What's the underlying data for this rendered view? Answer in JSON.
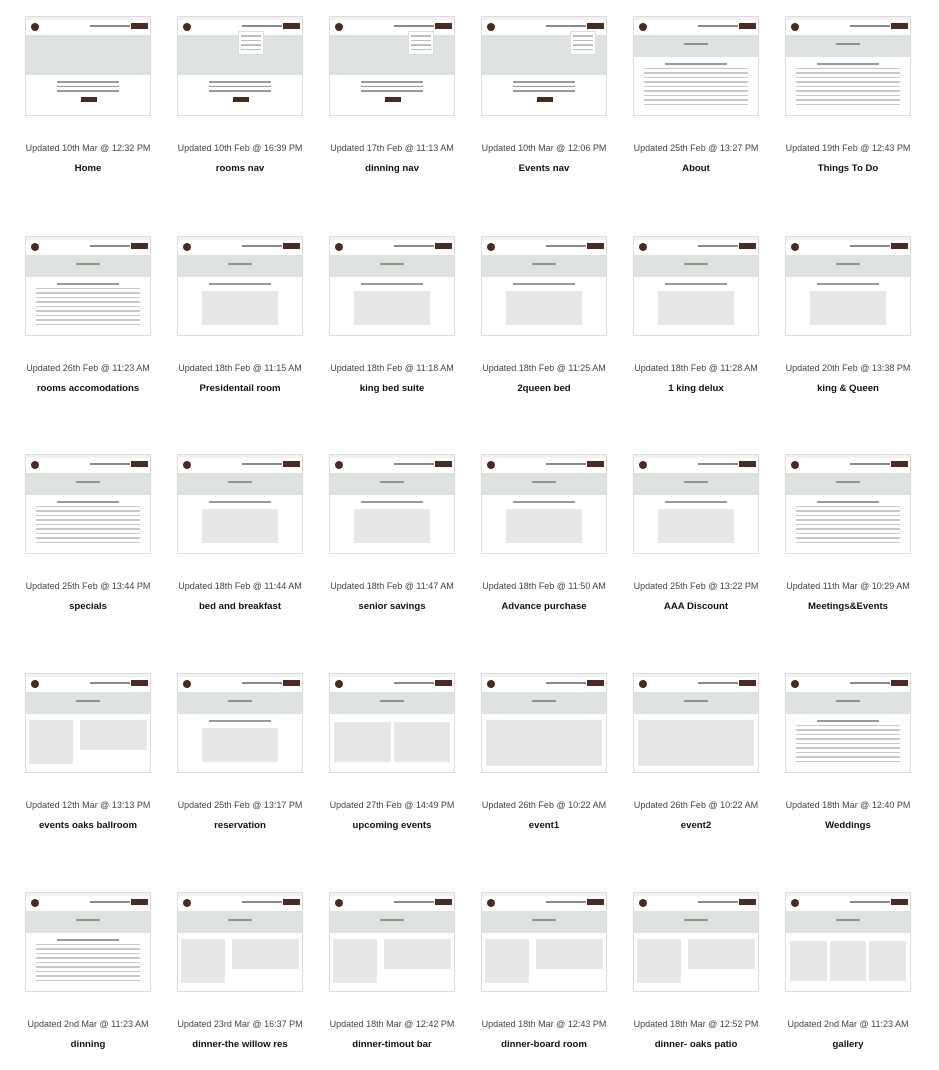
{
  "colors": {
    "brand": "#4a2a22",
    "hero": "#dfe3df",
    "text": "#222222"
  },
  "cards": [
    {
      "updated": "Updated 10th Mar @ 12:32 PM",
      "name": "Home",
      "kind": "home"
    },
    {
      "updated": "Updated 10th Feb @ 16:39 PM",
      "name": "rooms nav",
      "kind": "nav"
    },
    {
      "updated": "Updated 17th Feb @ 11:13 AM",
      "name": "dinning nav",
      "kind": "nav"
    },
    {
      "updated": "Updated 10th Mar @ 12:06 PM",
      "name": "Events nav",
      "kind": "nav"
    },
    {
      "updated": "Updated 25th Feb @ 13:27 PM",
      "name": "About",
      "kind": "text"
    },
    {
      "updated": "Updated 19th Feb @ 12:43 PM",
      "name": "Things To Do",
      "kind": "text"
    },
    {
      "updated": "Updated 26th Feb @ 11:23 AM",
      "name": "rooms accomodations",
      "kind": "text"
    },
    {
      "updated": "Updated 18th Feb @ 11:15 AM",
      "name": "Presidentail room",
      "kind": "box"
    },
    {
      "updated": "Updated 18th Feb @ 11:18 AM",
      "name": "king bed suite",
      "kind": "box"
    },
    {
      "updated": "Updated 18th Feb @ 11:25 AM",
      "name": "2queen bed",
      "kind": "box"
    },
    {
      "updated": "Updated 18th Feb @ 11:28 AM",
      "name": "1 king delux",
      "kind": "box"
    },
    {
      "updated": "Updated 20th Feb @ 13:38 PM",
      "name": "king & Queen",
      "kind": "box"
    },
    {
      "updated": "Updated 25th Feb @ 13:44 PM",
      "name": "specials",
      "kind": "text"
    },
    {
      "updated": "Updated 18th Feb @ 11:44 AM",
      "name": "bed and breakfast",
      "kind": "box"
    },
    {
      "updated": "Updated 18th Feb @ 11:47 AM",
      "name": "senior savings",
      "kind": "box"
    },
    {
      "updated": "Updated 18th Feb @ 11:50 AM",
      "name": "Advance purchase",
      "kind": "box"
    },
    {
      "updated": "Updated 25th Feb @ 13:22 PM",
      "name": "AAA Discount",
      "kind": "box"
    },
    {
      "updated": "Updated 11th Mar @ 10:29 AM",
      "name": "Meetings&Events",
      "kind": "text"
    },
    {
      "updated": "Updated 12th Mar @ 13:13 PM",
      "name": "events oaks ballroom",
      "kind": "split"
    },
    {
      "updated": "Updated 25th Feb @ 13:17 PM",
      "name": "reservation",
      "kind": "box"
    },
    {
      "updated": "Updated 27th Feb @ 14:49 PM",
      "name": "upcoming events",
      "kind": "cols"
    },
    {
      "updated": "Updated 26th Feb @ 10:22 AM",
      "name": "event1",
      "kind": "full"
    },
    {
      "updated": "Updated 26th Feb @ 10:22 AM",
      "name": "event2",
      "kind": "full"
    },
    {
      "updated": "Updated 18th Mar @ 12:40 PM",
      "name": "Weddings",
      "kind": "text"
    },
    {
      "updated": "Updated 2nd Mar @ 11:23 AM",
      "name": "dinning",
      "kind": "text"
    },
    {
      "updated": "Updated 23rd Mar @ 16:37 PM",
      "name": "dinner-the willow res",
      "kind": "split"
    },
    {
      "updated": "Updated 18th Mar @ 12:42 PM",
      "name": "dinner-timout bar",
      "kind": "split"
    },
    {
      "updated": "Updated 18th Mar @ 12:43 PM",
      "name": "dinner-board room",
      "kind": "split"
    },
    {
      "updated": "Updated 18th Mar @ 12:52 PM",
      "name": "dinner- oaks patio",
      "kind": "split"
    },
    {
      "updated": "Updated 2nd Mar @ 11:23 AM",
      "name": "gallery",
      "kind": "cols"
    }
  ]
}
